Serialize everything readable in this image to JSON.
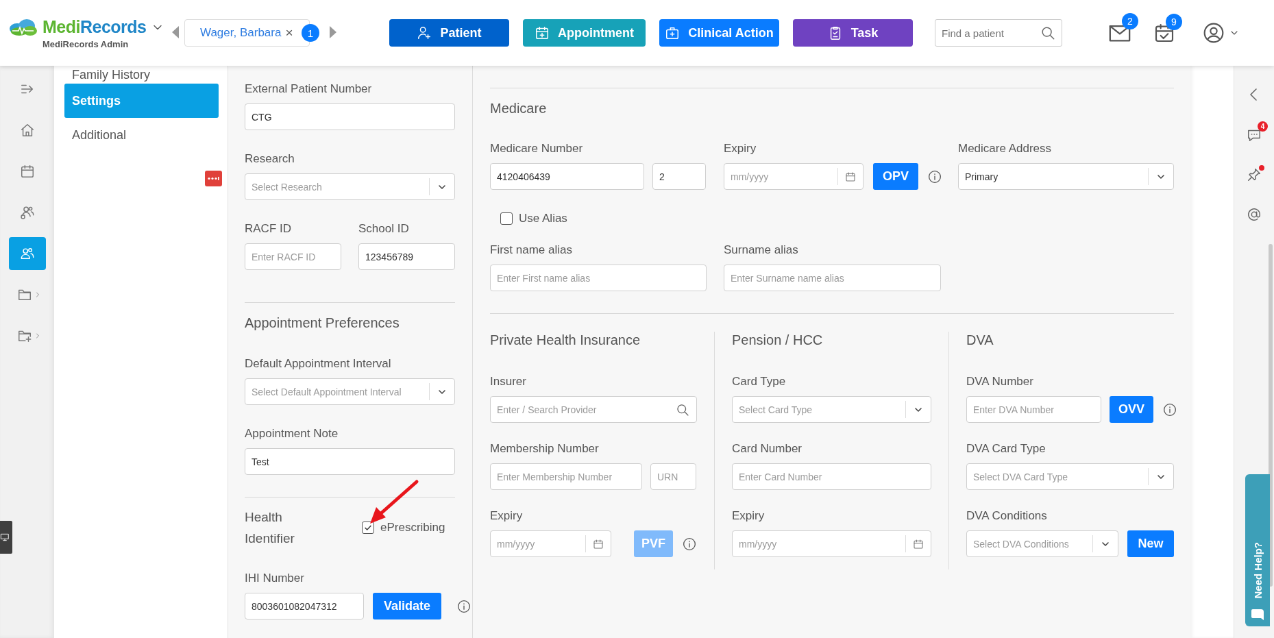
{
  "header": {
    "brand": {
      "first": "Medi",
      "second": "Records"
    },
    "subtitle": "MediRecords Admin",
    "patient_tab": {
      "name": "Wager, Barbara",
      "close": "×",
      "count": "1"
    },
    "actions": [
      {
        "kind": "patient",
        "label": "Patient",
        "color": "#0062cc"
      },
      {
        "kind": "appointment",
        "label": "Appointment",
        "color": "#17a2b8"
      },
      {
        "kind": "clinical",
        "label": "Clinical Action",
        "color": "#0a7cff"
      },
      {
        "kind": "task",
        "label": "Task",
        "color": "#6f42c1"
      }
    ],
    "search": {
      "placeholder": "Find a patient"
    },
    "mail_badge": "2",
    "calendar_badge": "9"
  },
  "rail": {
    "items": [
      {
        "kind": "expand",
        "selected": false,
        "expandable": false
      },
      {
        "kind": "home",
        "selected": false,
        "expandable": false
      },
      {
        "kind": "calendar",
        "selected": false,
        "expandable": false
      },
      {
        "kind": "contacts",
        "selected": false,
        "expandable": false
      },
      {
        "kind": "patients",
        "selected": true,
        "expandable": false
      },
      {
        "kind": "folder",
        "selected": false,
        "expandable": true
      },
      {
        "kind": "folder-add",
        "selected": false,
        "expandable": true
      }
    ]
  },
  "nav": {
    "items": [
      {
        "label": "Family History",
        "selected": false
      },
      {
        "label": "Settings",
        "selected": true
      },
      {
        "label": "Additional",
        "selected": false
      }
    ]
  },
  "patient_details": {
    "external_patient_number": {
      "label": "External Patient Number",
      "value": "CTG"
    },
    "research": {
      "label": "Research",
      "placeholder": "Select Research"
    },
    "racf_id": {
      "label": "RACF ID",
      "placeholder": "Enter RACF ID"
    },
    "school_id": {
      "label": "School ID",
      "value": "123456789"
    }
  },
  "appointment_preferences": {
    "title": "Appointment Preferences",
    "default_interval": {
      "label": "Default Appointment Interval",
      "placeholder": "Select Default Appointment Interval"
    },
    "note": {
      "label": "Appointment Note",
      "value": "Test"
    }
  },
  "health_identifier": {
    "title": "Health Identifier",
    "eprescribing": {
      "label": "ePrescribing",
      "checked": true
    },
    "ihi_number": {
      "label": "IHI Number",
      "value": "8003601082047312"
    },
    "validate_button": {
      "label": "Validate",
      "disabled": false
    }
  },
  "medicare": {
    "title": "Medicare",
    "number": {
      "label": "Medicare Number",
      "value": "4120406439"
    },
    "irn": {
      "value": "2"
    },
    "expiry": {
      "label": "Expiry",
      "placeholder": "mm/yyyy"
    },
    "verify_button": {
      "label": "OPV",
      "disabled": false
    },
    "address": {
      "label": "Medicare Address",
      "value": "Primary"
    },
    "use_alias": {
      "label": "Use Alias",
      "checked": false
    },
    "first_name_alias": {
      "label": "First name alias",
      "placeholder": "Enter First name alias"
    },
    "surname_alias": {
      "label": "Surname alias",
      "placeholder": "Enter Surname name alias"
    }
  },
  "private_health_insurance": {
    "title": "Private Health Insurance",
    "insurer": {
      "label": "Insurer",
      "placeholder": "Enter / Search Provider"
    },
    "membership_number": {
      "label": "Membership Number",
      "placeholder": "Enter Membership Number"
    },
    "urn": {
      "placeholder": "URN"
    },
    "expiry": {
      "label": "Expiry",
      "placeholder": "mm/yyyy"
    },
    "verify_button": {
      "label": "PVF",
      "disabled": true
    }
  },
  "pension": {
    "title": "Pension / HCC",
    "card_type": {
      "label": "Card Type",
      "placeholder": "Select Card Type"
    },
    "card_number": {
      "label": "Card Number",
      "placeholder": "Enter Card Number"
    },
    "expiry": {
      "label": "Expiry",
      "placeholder": "mm/yyyy"
    }
  },
  "dva": {
    "title": "DVA",
    "number": {
      "label": "DVA Number",
      "placeholder": "Enter DVA Number"
    },
    "verify_button": {
      "label": "OVV",
      "disabled": false
    },
    "card_type": {
      "label": "DVA Card Type",
      "placeholder": "Select DVA Card Type"
    },
    "conditions": {
      "label": "DVA Conditions",
      "placeholder": "Select DVA Conditions"
    },
    "new_button": {
      "label": "New",
      "disabled": false
    }
  },
  "right_rail": {
    "chat_badge": "4",
    "pin_alert": true
  },
  "help_tab": {
    "label": "Need Help?"
  }
}
